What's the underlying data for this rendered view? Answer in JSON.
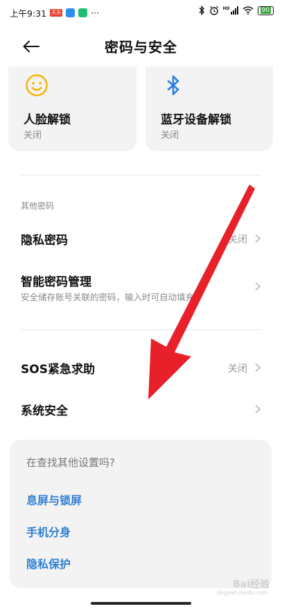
{
  "status_bar": {
    "time": "上午9:31",
    "badge": "天天",
    "dots": "···",
    "signal_label": "HD",
    "battery": "90"
  },
  "header": {
    "title": "密码与安全"
  },
  "cards": [
    {
      "title": "人脸解锁",
      "status": "关闭",
      "icon": "smiley-face-icon"
    },
    {
      "title": "蓝牙设备解锁",
      "status": "关闭",
      "icon": "bluetooth-icon"
    }
  ],
  "other_passwords": {
    "section_label": "其他密码",
    "privacy_password": {
      "label": "隐私密码",
      "value": "关闭"
    },
    "smart_password": {
      "label": "智能密码管理",
      "subtitle": "安全储存账号关联的密码，输入时可自动填充"
    }
  },
  "sos": {
    "label": "SOS紧急求助",
    "value": "关闭"
  },
  "system_security": {
    "label": "系统安全"
  },
  "search_more": {
    "question": "在查找其他设置吗?",
    "links": [
      "息屏与锁屏",
      "手机分身",
      "隐私保护"
    ]
  },
  "watermark": {
    "text": "Bai经验",
    "sub": "jingyan.baidu.com"
  },
  "colors": {
    "accent": "#2f7fd2",
    "arrow": "#e8202a",
    "smiley": "#f5b400",
    "bluetooth": "#2d7de0"
  }
}
